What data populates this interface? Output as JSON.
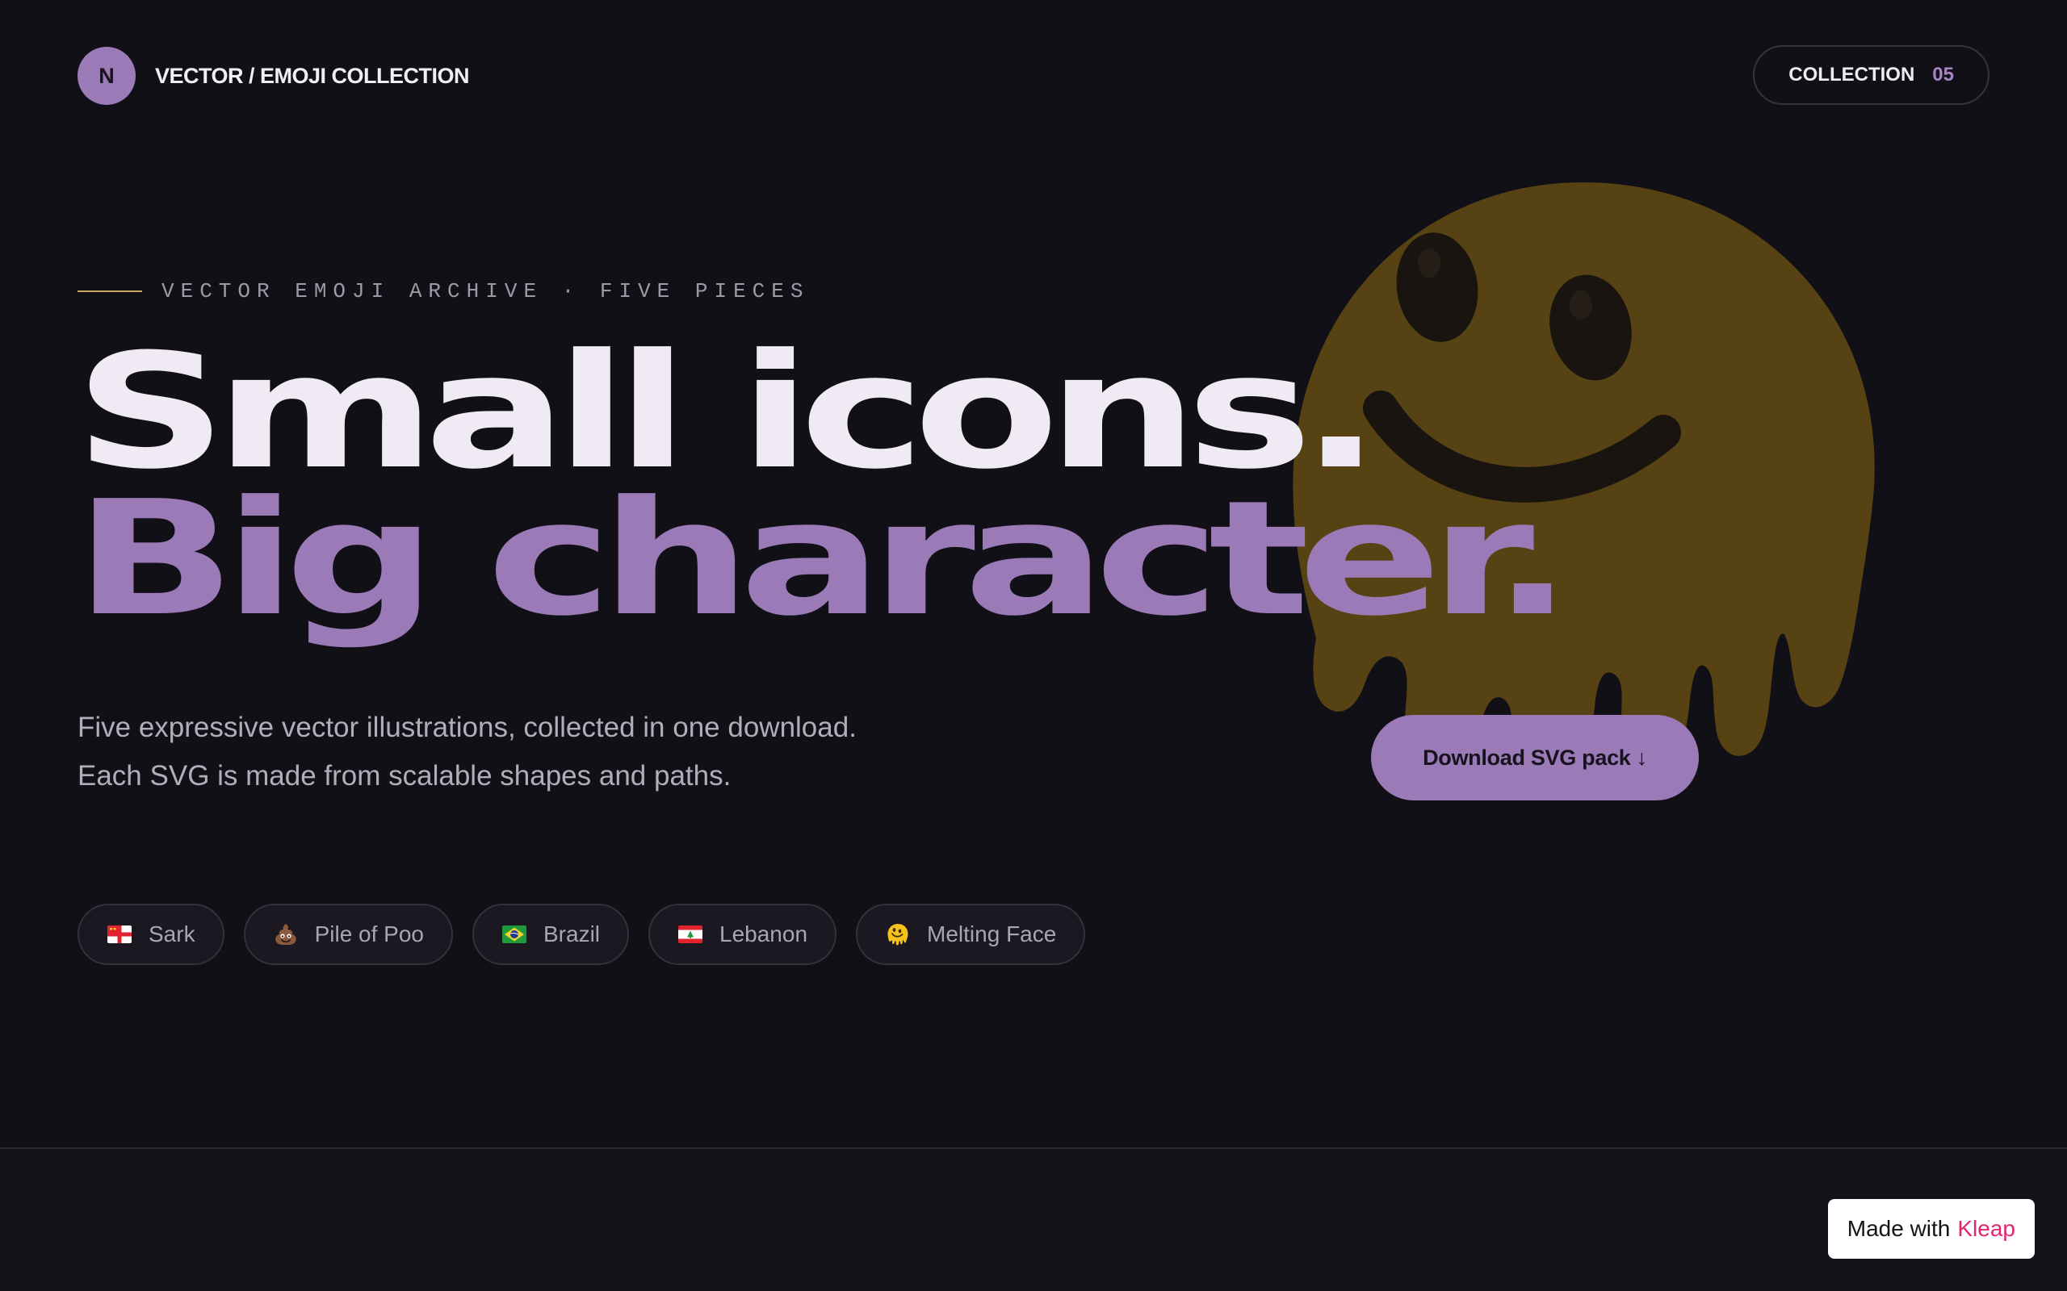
{
  "header": {
    "logo_letter": "N",
    "brand_name": "VECTOR / EMOJI COLLECTION",
    "collection_label": "COLLECTION",
    "collection_count": "05"
  },
  "hero": {
    "eyebrow": "VECTOR EMOJI ARCHIVE · FIVE PIECES",
    "headline_line_1": "Small icons.",
    "headline_line_2": "Big character.",
    "description_line_1": "Five expressive vector illustrations, collected in one download.",
    "description_line_2": "Each SVG is made from scalable shapes and paths.",
    "download_button": "Download SVG pack ↓",
    "background_icon": "melting-face-icon"
  },
  "tags": [
    {
      "label": "Sark",
      "icon": "sark-flag-icon"
    },
    {
      "label": "Pile of Poo",
      "icon": "pile-of-poo-icon"
    },
    {
      "label": "Brazil",
      "icon": "brazil-flag-icon"
    },
    {
      "label": "Lebanon",
      "icon": "lebanon-flag-icon"
    },
    {
      "label": "Melting Face",
      "icon": "melting-face-icon"
    }
  ],
  "badge": {
    "prefix": "Made with",
    "brand": "Kleap"
  },
  "colors": {
    "background": "#121017",
    "accent": "#9b7ab8",
    "eyebrow_rule": "#c9a86a",
    "badge_brand": "#e3246f"
  }
}
